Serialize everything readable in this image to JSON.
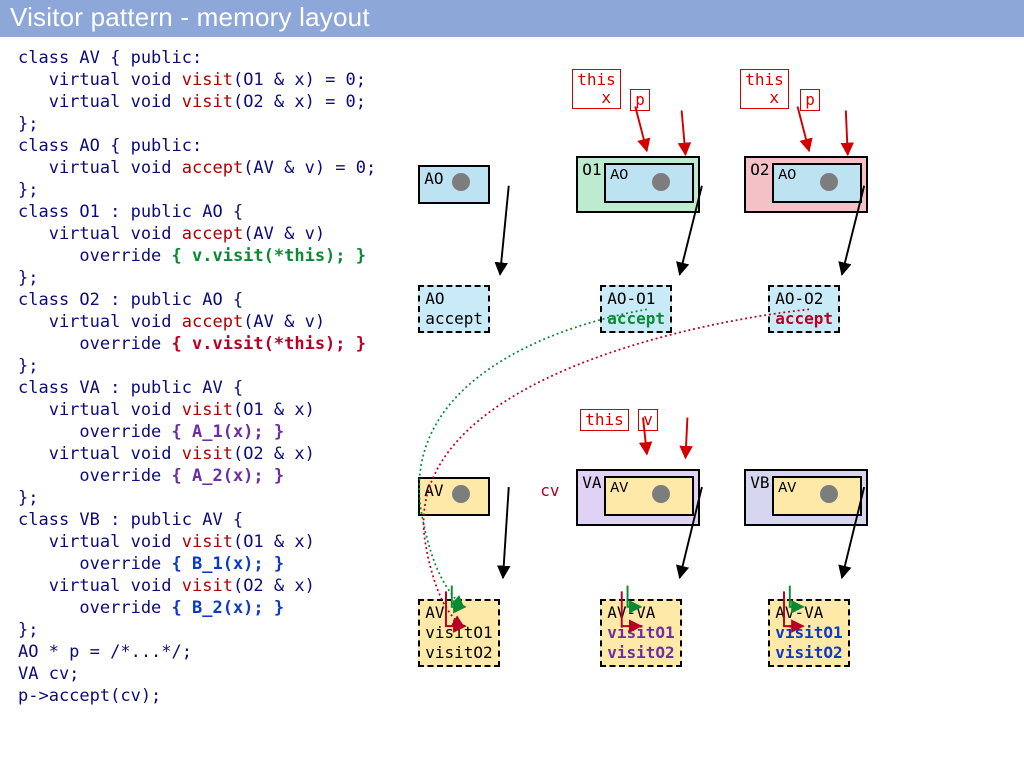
{
  "title": "Visitor pattern - memory layout",
  "ann": {
    "thisx1": "this\n  x",
    "p": "p",
    "thisx2": "this\n  x",
    "p2": "p",
    "this3": "this",
    "v": "v",
    "cv": "cv"
  },
  "boxes": {
    "ao": "AO",
    "o1": "O1",
    "o1_sub": "AO",
    "o2": "O2",
    "o2_sub": "AO",
    "av": "AV",
    "va": "VA",
    "va_sub": "AV",
    "vb": "VB",
    "vb_sub": "AV"
  },
  "vt": {
    "ao": {
      "h": "AO",
      "a": "accept"
    },
    "ao_o1": {
      "h": "AO-O1",
      "a": "accept"
    },
    "ao_o2": {
      "h": "AO-O2",
      "a": "accept"
    },
    "av": {
      "h": "AV",
      "v1": "visitO1",
      "v2": "visitO2"
    },
    "av_va": {
      "h": "AV-VA",
      "v1": "visitO1",
      "v2": "visitO2"
    },
    "av_vb": {
      "h": "AV-VA",
      "v1": "visitO1",
      "v2": "visitO2"
    }
  },
  "code_lines": [
    [
      [
        "class AV { public:",
        null
      ]
    ],
    [
      [
        "   virtual void ",
        null
      ],
      [
        "visit",
        "c-name"
      ],
      [
        "(O1 & x) = 0;",
        null
      ]
    ],
    [
      [
        "   virtual void ",
        null
      ],
      [
        "visit",
        "c-name"
      ],
      [
        "(O2 & x) = 0;",
        null
      ]
    ],
    [
      [
        "};",
        null
      ]
    ],
    [
      [
        "class AO { public:",
        null
      ]
    ],
    [
      [
        "   virtual void ",
        null
      ],
      [
        "accept",
        "c-name"
      ],
      [
        "(AV & v) = 0;",
        null
      ]
    ],
    [
      [
        "};",
        null
      ]
    ],
    [
      [
        "class O1 : public AO {",
        null
      ]
    ],
    [
      [
        "   virtual void ",
        null
      ],
      [
        "accept",
        "c-name"
      ],
      [
        "(AV & v)",
        null
      ]
    ],
    [
      [
        "      override ",
        null
      ],
      [
        "{ v.visit(*this); }",
        "c-g"
      ]
    ],
    [
      [
        "};",
        null
      ]
    ],
    [
      [
        "class O2 : public AO {",
        null
      ]
    ],
    [
      [
        "   virtual void ",
        null
      ],
      [
        "accept",
        "c-name"
      ],
      [
        "(AV & v)",
        null
      ]
    ],
    [
      [
        "      override ",
        null
      ],
      [
        "{ v.visit(*this); }",
        "c-r"
      ]
    ],
    [
      [
        "};",
        null
      ]
    ],
    [
      [
        "class VA : public AV {",
        null
      ]
    ],
    [
      [
        "   virtual void ",
        null
      ],
      [
        "visit",
        "c-name"
      ],
      [
        "(O1 & x)",
        null
      ]
    ],
    [
      [
        "      override ",
        null
      ],
      [
        "{ A_1(x); }",
        "c-p"
      ]
    ],
    [
      [
        "   virtual void ",
        null
      ],
      [
        "visit",
        "c-name"
      ],
      [
        "(O2 & x)",
        null
      ]
    ],
    [
      [
        "      override ",
        null
      ],
      [
        "{ A_2(x); }",
        "c-p"
      ]
    ],
    [
      [
        "};",
        null
      ]
    ],
    [
      [
        "class VB : public AV {",
        null
      ]
    ],
    [
      [
        "   virtual void ",
        null
      ],
      [
        "visit",
        "c-name"
      ],
      [
        "(O1 & x)",
        null
      ]
    ],
    [
      [
        "      override ",
        null
      ],
      [
        "{ B_1(x); }",
        "c-b"
      ]
    ],
    [
      [
        "   virtual void ",
        null
      ],
      [
        "visit",
        "c-name"
      ],
      [
        "(O2 & x)",
        null
      ]
    ],
    [
      [
        "      override ",
        null
      ],
      [
        "{ B_2(x); }",
        "c-b"
      ]
    ],
    [
      [
        "};",
        null
      ]
    ],
    [
      [
        "AO * p = /*...*/;",
        null
      ]
    ],
    [
      [
        "VA cv;",
        null
      ]
    ],
    [
      [
        "p->accept(cv);",
        null
      ]
    ]
  ]
}
